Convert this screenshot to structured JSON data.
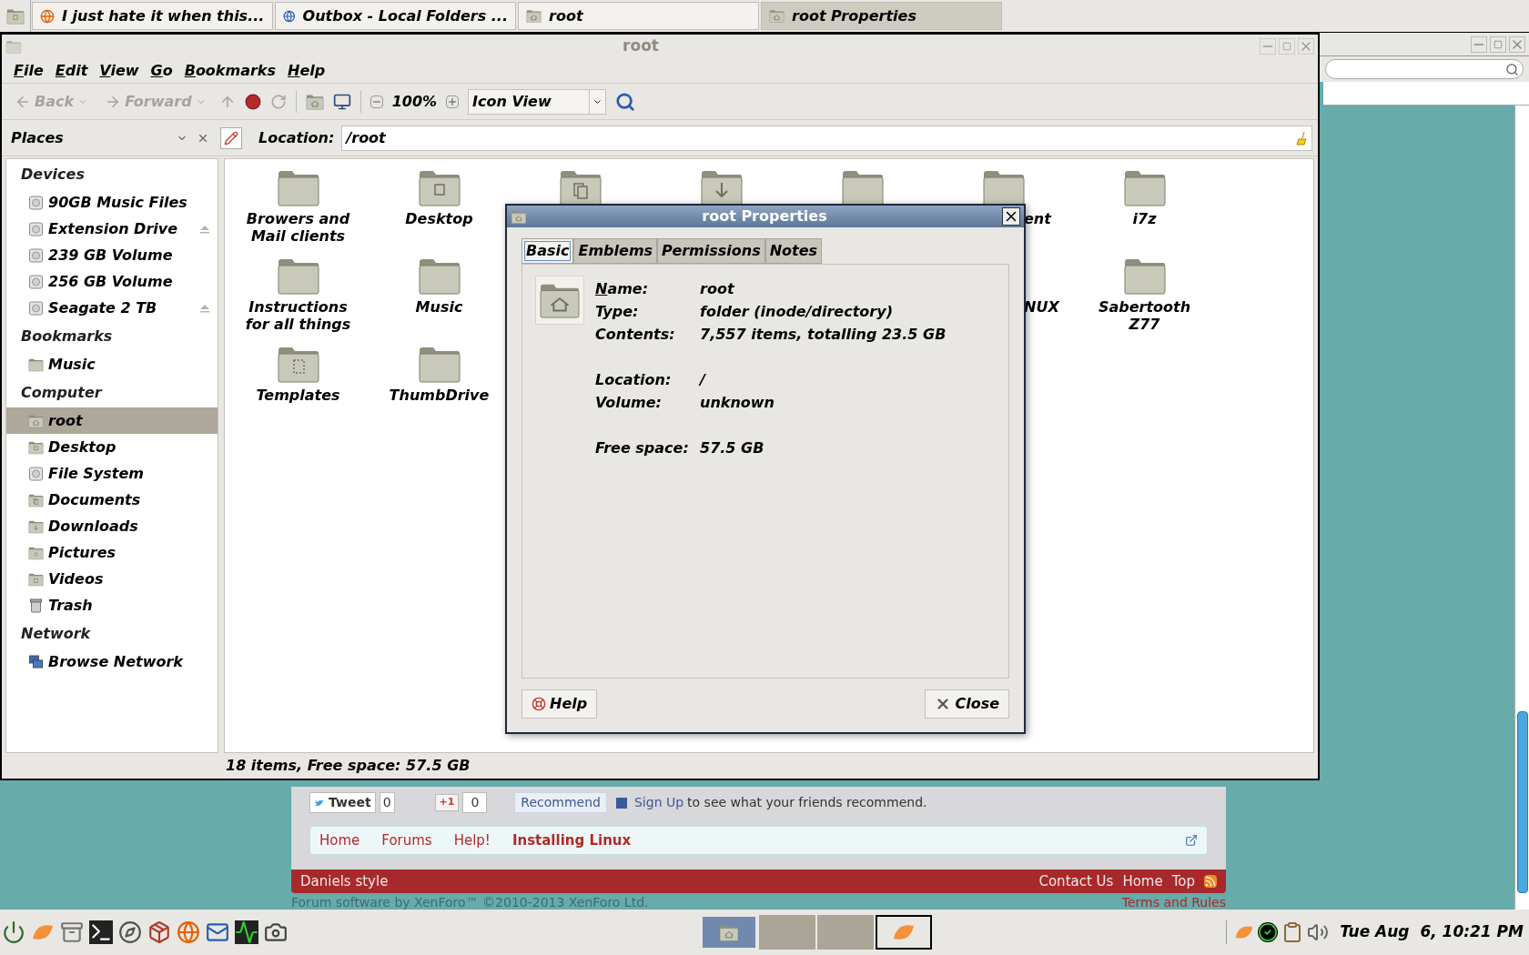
{
  "panel": {
    "tasks": [
      {
        "title": "I just hate it when this...",
        "kind": "browser",
        "selected": false
      },
      {
        "title": "Outbox - Local Folders ...",
        "kind": "mail",
        "selected": false
      },
      {
        "title": "root",
        "kind": "folder",
        "selected": false
      },
      {
        "title": "root Properties",
        "kind": "folder",
        "selected": true
      }
    ]
  },
  "browser": {
    "share": {
      "tweet": "Tweet",
      "tweet_count": "0",
      "plus": "+1",
      "plus_count": "0",
      "recommend": "Recommend",
      "signup_link": "Sign Up",
      "signup_text": "to see what your friends recommend."
    },
    "breadcrumb": [
      {
        "label": "Home",
        "current": false
      },
      {
        "label": "Forums",
        "current": false
      },
      {
        "label": "Help!",
        "current": false
      },
      {
        "label": "Installing Linux",
        "current": true
      }
    ],
    "footer": {
      "style": "Daniels style",
      "links": [
        "Contact Us",
        "Home",
        "Top"
      ]
    },
    "copyright": "Forum software by XenForo™ ©2010-2013 XenForo Ltd.",
    "terms": "Terms and Rules"
  },
  "file_manager": {
    "title": "root",
    "menu": [
      "File",
      "Edit",
      "View",
      "Go",
      "Bookmarks",
      "Help"
    ],
    "toolbar": {
      "back": {
        "label": "Back",
        "disabled": true
      },
      "forward": {
        "label": "Forward",
        "disabled": true
      },
      "zoom": "100%",
      "view": "Icon View"
    },
    "places_label": "Places",
    "location_label": "Location:",
    "location": "/root",
    "sidebar": [
      {
        "heading": "Devices",
        "items": [
          {
            "label": "90GB Music Files",
            "kind": "drive",
            "ejectable": false,
            "selected": false
          },
          {
            "label": "Extension Drive",
            "kind": "drive",
            "ejectable": true,
            "selected": false
          },
          {
            "label": "239 GB Volume",
            "kind": "drive",
            "ejectable": false,
            "selected": false
          },
          {
            "label": "256 GB Volume",
            "kind": "drive",
            "ejectable": false,
            "selected": false
          },
          {
            "label": "Seagate 2 TB",
            "kind": "drive",
            "ejectable": true,
            "selected": false
          }
        ]
      },
      {
        "heading": "Bookmarks",
        "items": [
          {
            "label": "Music",
            "kind": "folder",
            "ejectable": false,
            "selected": false
          }
        ]
      },
      {
        "heading": "Computer",
        "items": [
          {
            "label": "root",
            "kind": "home",
            "ejectable": false,
            "selected": true
          },
          {
            "label": "Desktop",
            "kind": "desktop",
            "ejectable": false,
            "selected": false
          },
          {
            "label": "File System",
            "kind": "drive",
            "ejectable": false,
            "selected": false
          },
          {
            "label": "Documents",
            "kind": "documents",
            "ejectable": false,
            "selected": false
          },
          {
            "label": "Downloads",
            "kind": "downloads",
            "ejectable": false,
            "selected": false
          },
          {
            "label": "Pictures",
            "kind": "pictures",
            "ejectable": false,
            "selected": false
          },
          {
            "label": "Videos",
            "kind": "videos",
            "ejectable": false,
            "selected": false
          },
          {
            "label": "Trash",
            "kind": "trash",
            "ejectable": false,
            "selected": false
          }
        ]
      },
      {
        "heading": "Network",
        "items": [
          {
            "label": "Browse Network",
            "kind": "network",
            "ejectable": false,
            "selected": false
          }
        ]
      }
    ],
    "rows": [
      [
        {
          "kind": "plain",
          "label": "Browers and Mail clients"
        },
        {
          "kind": "desktop",
          "label": "Desktop"
        },
        {
          "kind": "documents"
        },
        {
          "kind": "downloads"
        },
        {
          "kind": "plain"
        },
        {
          "kind": "plain",
          "label": "ent",
          "clipped": true
        },
        {
          "kind": "plain",
          "label": "i7z"
        }
      ],
      [
        {
          "kind": "plain",
          "label": "Instructions for all things"
        },
        {
          "kind": "plain",
          "label": "Music"
        },
        {
          "kind": "hidden"
        },
        {
          "kind": "hidden"
        },
        {
          "kind": "hidden"
        },
        {
          "kind": "hidden",
          "label": "NUX",
          "clipped": true
        },
        {
          "kind": "plain",
          "label": "Sabertooth Z77"
        }
      ],
      [
        {
          "kind": "templates",
          "label": "Templates"
        },
        {
          "kind": "plain",
          "label": "ThumbDrive"
        }
      ]
    ],
    "status": "18 items, Free space: 57.5 GB"
  },
  "dialog": {
    "title": "root Properties",
    "tabs": [
      {
        "label": "Basic",
        "selected": true
      },
      {
        "label": "Emblems",
        "selected": false
      },
      {
        "label": "Permissions",
        "selected": false
      },
      {
        "label": "Notes",
        "selected": false
      }
    ],
    "groups": [
      [
        {
          "label": "Name:",
          "value": "root",
          "mnemonic": true
        },
        {
          "label": "Type:",
          "value": "folder (inode/directory)",
          "mnemonic": false
        },
        {
          "label": "Contents:",
          "value": "7,557 items, totalling 23.5 GB",
          "mnemonic": false
        }
      ],
      [
        {
          "label": "Location:",
          "value": "/",
          "mnemonic": false
        },
        {
          "label": "Volume:",
          "value": "unknown",
          "mnemonic": false
        }
      ],
      [
        {
          "label": "Free space:",
          "value": "57.5 GB",
          "mnemonic": false
        }
      ]
    ],
    "buttons": [
      {
        "label": "Help",
        "kind": "help"
      },
      {
        "label": "Close",
        "kind": "close"
      }
    ]
  },
  "taskbar": {
    "windows": [
      {
        "kind": "folder",
        "selected": true
      },
      {
        "kind": "blank",
        "selected": false
      },
      {
        "kind": "blank",
        "selected": false
      },
      {
        "kind": "orange",
        "selected": false
      }
    ],
    "clock": "Tue Aug  6, 10:21 PM"
  }
}
